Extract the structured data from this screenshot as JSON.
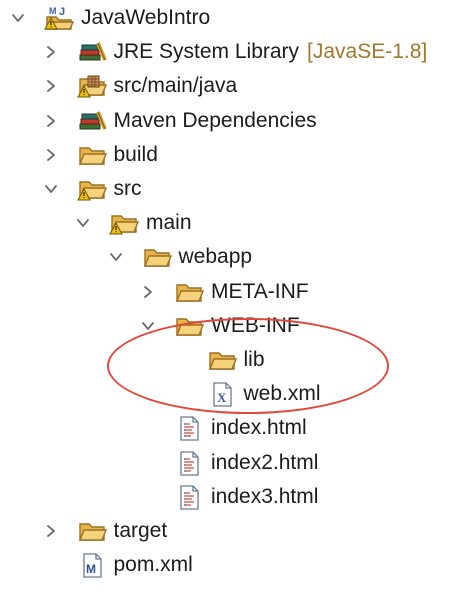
{
  "project_explorer": {
    "items": [
      {
        "label": "JavaWebIntro",
        "icon": "java-project-icon",
        "expander": "open",
        "depth": 0,
        "row": 0
      },
      {
        "label": "JRE System Library",
        "decoration": "[JavaSE-1.8]",
        "icon": "library-icon",
        "expander": "closed",
        "depth": 1,
        "row": 1
      },
      {
        "label": "src/main/java",
        "icon": "source-folder-icon",
        "expander": "closed",
        "depth": 1,
        "row": 2
      },
      {
        "label": "Maven Dependencies",
        "icon": "library-icon",
        "expander": "closed",
        "depth": 1,
        "row": 3
      },
      {
        "label": "build",
        "icon": "folder-icon",
        "expander": "closed",
        "depth": 1,
        "row": 4
      },
      {
        "label": "src",
        "icon": "folder-warning-icon",
        "expander": "open",
        "depth": 1,
        "row": 5
      },
      {
        "label": "main",
        "icon": "folder-warning-icon",
        "expander": "open",
        "depth": 2,
        "row": 6
      },
      {
        "label": "webapp",
        "icon": "folder-icon",
        "expander": "open",
        "depth": 3,
        "row": 7
      },
      {
        "label": "META-INF",
        "icon": "folder-icon",
        "expander": "closed",
        "depth": 4,
        "row": 8
      },
      {
        "label": "WEB-INF",
        "icon": "folder-icon",
        "expander": "open",
        "depth": 4,
        "row": 9
      },
      {
        "label": "lib",
        "icon": "folder-icon",
        "expander": "none",
        "depth": 5,
        "row": 10
      },
      {
        "label": "web.xml",
        "icon": "xml-file-icon",
        "expander": "none",
        "depth": 5,
        "row": 11
      },
      {
        "label": "index.html",
        "icon": "html-file-icon",
        "expander": "none",
        "depth": 4,
        "row": 12
      },
      {
        "label": "index2.html",
        "icon": "html-file-icon",
        "expander": "none",
        "depth": 4,
        "row": 13
      },
      {
        "label": "index3.html",
        "icon": "html-file-icon",
        "expander": "none",
        "depth": 4,
        "row": 14
      },
      {
        "label": "target",
        "icon": "folder-icon",
        "expander": "closed",
        "depth": 1,
        "row": 15
      },
      {
        "label": "pom.xml",
        "icon": "maven-pom-icon",
        "expander": "none",
        "depth": 1,
        "row": 16
      }
    ],
    "colors": {
      "folder": "#f3c867",
      "folder_outline": "#a9782a",
      "warning": "#f2c200",
      "highlight_ring": "#e2473a",
      "decoration_text": "#a0772b"
    }
  }
}
